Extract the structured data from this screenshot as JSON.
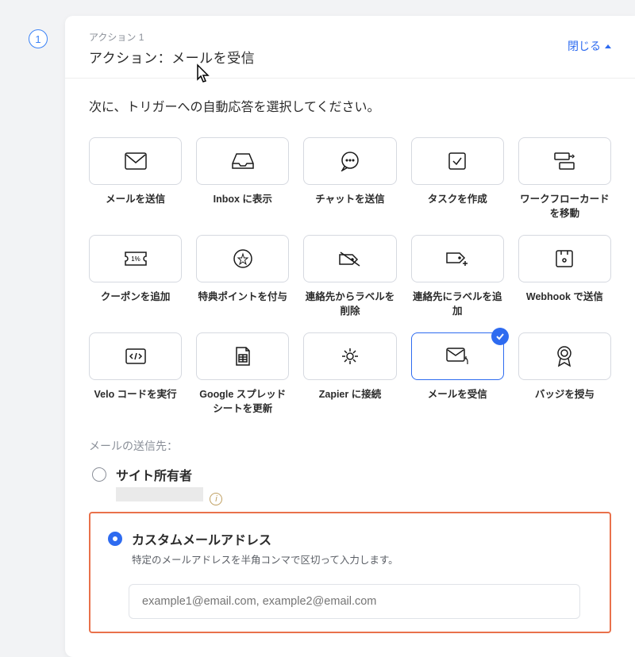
{
  "step": {
    "number": "1"
  },
  "header": {
    "sub": "アクション 1",
    "title": "アクション：メールを受信",
    "close": "閉じる"
  },
  "prompt": "次に、トリガーへの自動応答を選択してください。",
  "tiles": [
    {
      "label": "メールを送信",
      "icon": "mail-icon"
    },
    {
      "label": "Inbox に表示",
      "icon": "inbox-icon"
    },
    {
      "label": "チャットを送信",
      "icon": "chat-icon"
    },
    {
      "label": "タスクを作成",
      "icon": "task-icon"
    },
    {
      "label": "ワークフローカードを移動",
      "icon": "workflow-icon"
    },
    {
      "label": "クーポンを追加",
      "icon": "coupon-icon"
    },
    {
      "label": "特典ポイントを付与",
      "icon": "star-icon"
    },
    {
      "label": "連絡先からラベルを削除",
      "icon": "label-remove-icon"
    },
    {
      "label": "連絡先にラベルを追加",
      "icon": "label-add-icon"
    },
    {
      "label": "Webhook で送信",
      "icon": "webhook-icon"
    },
    {
      "label": "Velo コードを実行",
      "icon": "code-icon"
    },
    {
      "label": "Google スプレッドシートを更新",
      "icon": "sheet-icon"
    },
    {
      "label": "Zapier に接続",
      "icon": "zapier-icon"
    },
    {
      "label": "メールを受信",
      "icon": "mail-receive-icon",
      "selected": true
    },
    {
      "label": "バッジを授与",
      "icon": "badge-icon"
    }
  ],
  "recipients": {
    "section_label": "メールの送信先：",
    "options": [
      {
        "label": "サイト所有者",
        "sub": "",
        "redacted": true,
        "selected": false,
        "info": true
      },
      {
        "label": "カスタムメールアドレス",
        "sub": "特定のメールアドレスを半角コンマで区切って入力します。",
        "selected": true
      }
    ],
    "input_placeholder": "example1@email.com, example2@email.com"
  }
}
